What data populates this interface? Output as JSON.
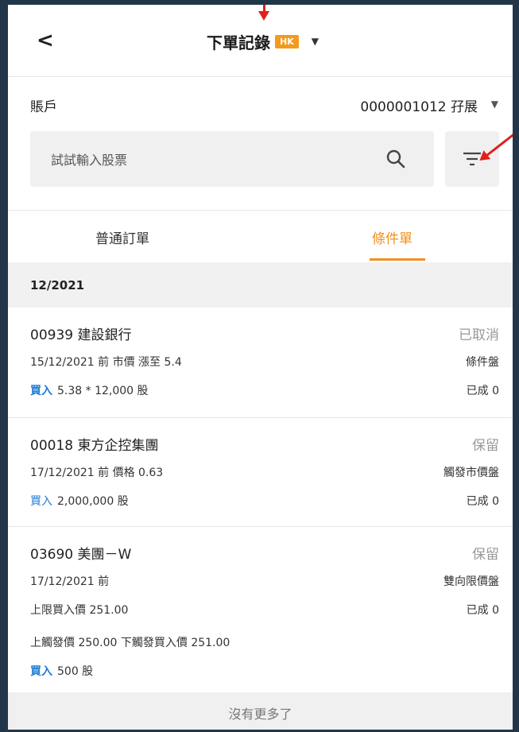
{
  "header": {
    "back_glyph": "<",
    "title": "下單記錄",
    "market_badge": "HK",
    "caret": "▼"
  },
  "account": {
    "label": "賬戶",
    "value": "0000001012 孖展",
    "caret": "▼"
  },
  "search": {
    "placeholder": "試試輸入股票",
    "icon": "search-icon",
    "filter_icon": "filter-icon"
  },
  "tabs": [
    {
      "label": "普通訂單",
      "active": false
    },
    {
      "label": "條件單",
      "active": true
    }
  ],
  "colors": {
    "accent": "#f0901e",
    "buy": "#1c7bd6",
    "badge": "#f59a1b",
    "annotation_arrow": "#e0201b"
  },
  "section": {
    "title": "12/2021"
  },
  "orders": [
    {
      "code_name": "00939 建設銀行",
      "status": "已取消",
      "line1": "15/12/2021 前  市價 漲至 5.4",
      "type": "條件盤",
      "side": "買入",
      "line2": "5.38 * 12,000 股",
      "filled": "已成 0"
    },
    {
      "code_name": "00018 東方企控集團",
      "status": "保留",
      "line1": "17/12/2021 前  價格 0.63",
      "type": "觸發市價盤",
      "side": "買入",
      "line2": "2,000,000 股",
      "filled": "已成 0"
    },
    {
      "code_name": "03690 美團－W",
      "status": "保留",
      "line1": "17/12/2021 前",
      "type": "雙向限價盤",
      "line_mid": "上限買入價 251.00",
      "filled": "已成 0",
      "line3": "上觸發價 250.00  下觸發買入價 251.00",
      "side": "買入",
      "line2": "500 股"
    }
  ],
  "footer": {
    "text": "沒有更多了"
  }
}
